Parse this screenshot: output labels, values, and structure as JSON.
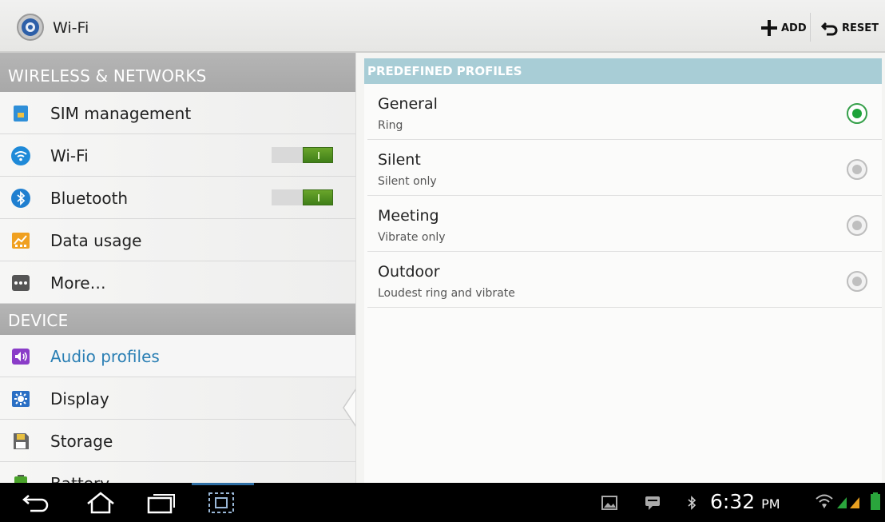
{
  "actionbar": {
    "title": "Wi-Fi",
    "add_label": "ADD",
    "reset_label": "RESET"
  },
  "left_pane": {
    "wireless_header": "WIRELESS & NETWORKS",
    "device_header": "DEVICE",
    "items": [
      {
        "label": "SIM management",
        "icon": "sim-card-icon"
      },
      {
        "label": "Wi-Fi",
        "icon": "wifi-icon",
        "toggle": "on"
      },
      {
        "label": "Bluetooth",
        "icon": "bluetooth-icon",
        "toggle": "on"
      },
      {
        "label": "Data usage",
        "icon": "data-usage-icon"
      },
      {
        "label": "More…",
        "icon": "more-icon"
      },
      {
        "label": "Audio profiles",
        "icon": "audio-profiles-icon",
        "selected": true
      },
      {
        "label": "Display",
        "icon": "display-icon"
      },
      {
        "label": "Storage",
        "icon": "storage-icon"
      },
      {
        "label": "Battery",
        "icon": "battery-icon"
      }
    ]
  },
  "right_pane": {
    "header": "PREDEFINED PROFILES",
    "profiles": [
      {
        "name": "General",
        "sub": "Ring",
        "selected": true
      },
      {
        "name": "Silent",
        "sub": "Silent only",
        "selected": false
      },
      {
        "name": "Meeting",
        "sub": "Vibrate only",
        "selected": false
      },
      {
        "name": "Outdoor",
        "sub": "Loudest ring and vibrate",
        "selected": false
      }
    ]
  },
  "statusbar": {
    "time": "6:32",
    "ampm": "PM"
  },
  "colors": {
    "accent_blue": "#2a7fb4",
    "section_header": "#aaaaaa",
    "profiles_header": "#a8cdd6",
    "toggle_on": "#4e8f20",
    "radio_on": "#1ea33a"
  }
}
